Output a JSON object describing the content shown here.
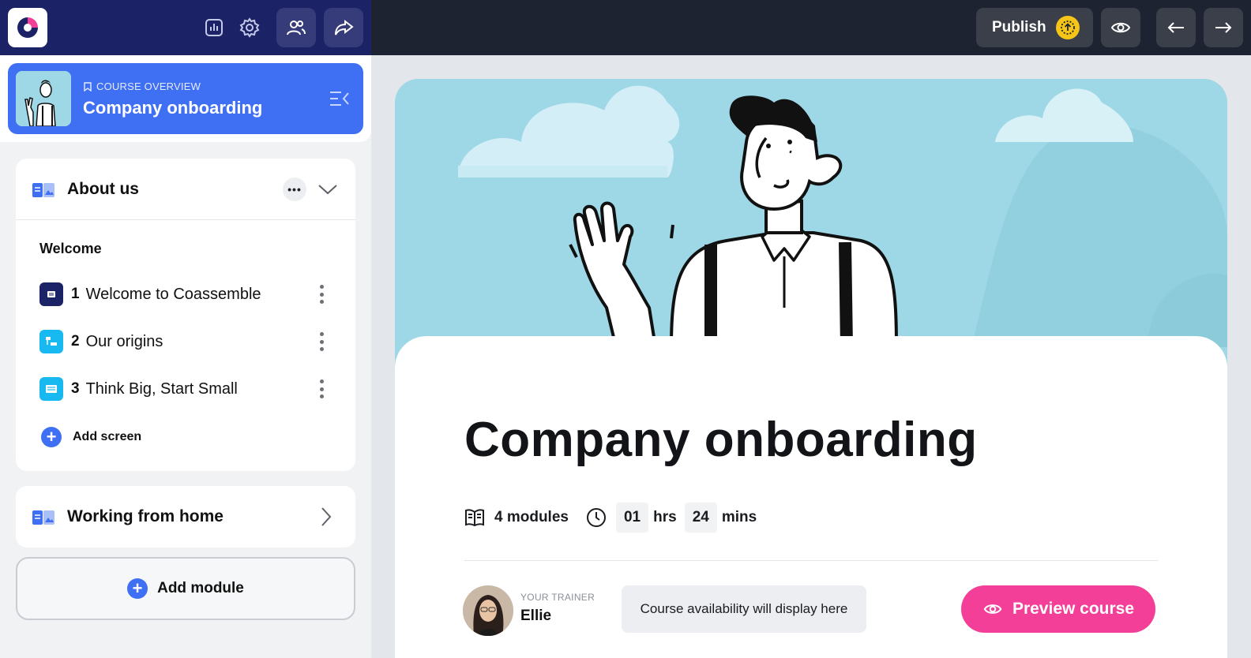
{
  "topbar": {
    "logo_icon": "coassemble-logo",
    "tools": [
      "analytics-icon",
      "settings-icon",
      "users-icon",
      "share-icon"
    ],
    "publish_label": "Publish",
    "preview_icon": "eye-icon",
    "back_icon": "arrow-left-icon",
    "forward_icon": "arrow-right-icon"
  },
  "sidebar": {
    "course_kicker": "COURSE OVERVIEW",
    "course_title": "Company onboarding",
    "modules": [
      {
        "title": "About us",
        "section": "Welcome",
        "screens": [
          {
            "num": "1",
            "label": "Welcome to Coassemble",
            "color": "#1c2266"
          },
          {
            "num": "2",
            "label": "Our origins",
            "color": "#18b9f0"
          },
          {
            "num": "3",
            "label": "Think Big, Start Small",
            "color": "#18b9f0"
          }
        ],
        "add_screen_label": "Add screen"
      },
      {
        "title": "Working from home"
      }
    ],
    "add_module_label": "Add module"
  },
  "main": {
    "title": "Company onboarding",
    "modules_count": "4 modules",
    "hours": "01",
    "hours_unit": "hrs",
    "mins": "24",
    "mins_unit": "mins",
    "trainer_kicker": "YOUR TRAINER",
    "trainer_name": "Ellie",
    "availability_text": "Course availability will display here",
    "preview_label": "Preview course"
  },
  "colors": {
    "topbar_left": "#1c2266",
    "topbar_right": "#1d2330",
    "accent_blue": "#3f6ff3",
    "accent_pink": "#f43f99",
    "hero_sky": "#9ed8e6",
    "publish_badge": "#f5c518"
  }
}
